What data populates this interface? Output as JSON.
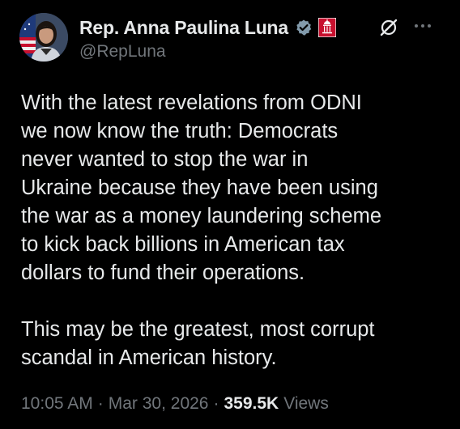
{
  "author": {
    "display_name": "Rep. Anna Paulina Luna",
    "handle": "@RepLuna",
    "verified_badge_icon": "verified-gray-check-icon",
    "affiliation_badge_icon": "congress-affiliation-icon"
  },
  "header_actions": {
    "grok_icon": "grok-slash-icon",
    "more_icon": "more-dots-icon"
  },
  "tweet": {
    "paragraph1": [
      "With the latest revelations from ODNI",
      "we now know the truth: Democrats",
      "never wanted to stop the war in",
      "Ukraine because they have been using",
      "the war as a money laundering scheme",
      "to kick back billions in American tax",
      "dollars to fund their operations."
    ],
    "paragraph2": [
      "This may be the greatest, most corrupt",
      "scandal in American history."
    ]
  },
  "meta": {
    "time": "10:05 AM",
    "separator": "·",
    "date": "Mar 30, 2026",
    "views_count": "359.5K",
    "views_label": "Views"
  },
  "colors": {
    "background": "#000000",
    "text": "#e7e9ea",
    "secondary": "#71767b",
    "verified_badge": "#829aab",
    "affiliation_badge": "#c8102e"
  }
}
